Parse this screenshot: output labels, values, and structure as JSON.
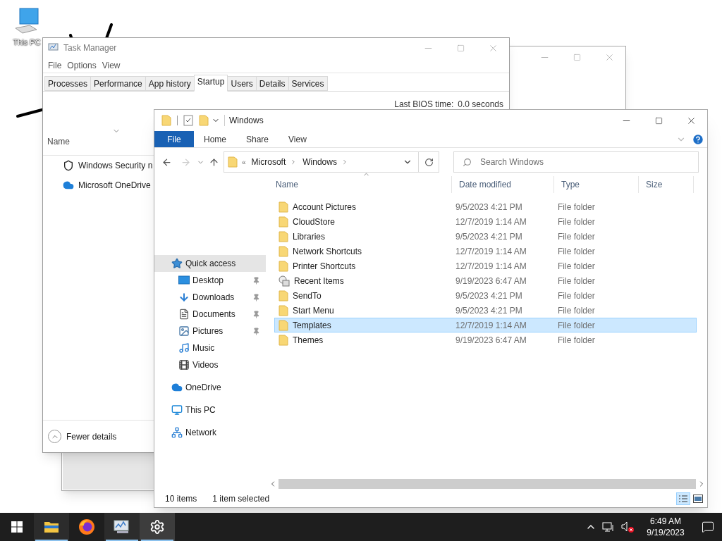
{
  "desktop": {
    "icons": [
      {
        "label": "This PC"
      }
    ]
  },
  "task_manager": {
    "title": "Task Manager",
    "menu": [
      "File",
      "Options",
      "View"
    ],
    "tabs": [
      {
        "label": "Processes",
        "selected": false
      },
      {
        "label": "Performance",
        "selected": false
      },
      {
        "label": "App history",
        "selected": false
      },
      {
        "label": "Startup",
        "selected": true
      },
      {
        "label": "Users",
        "selected": false
      },
      {
        "label": "Details",
        "selected": false
      },
      {
        "label": "Services",
        "selected": false
      }
    ],
    "bios_label": "Last BIOS time:",
    "bios_value": "0.0 seconds",
    "column": "Name",
    "startup_items": [
      {
        "name": "Windows Security n",
        "kind": "shield"
      },
      {
        "name": "Microsoft OneDrive",
        "kind": "cloud"
      }
    ],
    "footer": "Fewer details"
  },
  "explorer": {
    "title": "Windows",
    "ribbon_tabs": [
      {
        "label": "File",
        "kind": "file"
      },
      {
        "label": "Home",
        "kind": "tab"
      },
      {
        "label": "Share",
        "kind": "tab"
      },
      {
        "label": "View",
        "kind": "tab"
      }
    ],
    "overflow_mark": "«",
    "path": [
      "Microsoft",
      "Windows"
    ],
    "search": {
      "placeholder": "Search Windows"
    },
    "nav": [
      {
        "label": "Quick access",
        "kind": "quick",
        "selected": true,
        "children": [
          {
            "label": "Desktop",
            "kind": "desktop",
            "pinned": true
          },
          {
            "label": "Downloads",
            "kind": "downloads",
            "pinned": true
          },
          {
            "label": "Documents",
            "kind": "documents",
            "pinned": true
          },
          {
            "label": "Pictures",
            "kind": "pictures",
            "pinned": true
          },
          {
            "label": "Music",
            "kind": "music",
            "pinned": false
          },
          {
            "label": "Videos",
            "kind": "videos",
            "pinned": false
          }
        ]
      },
      {
        "label": "OneDrive",
        "kind": "onedrive",
        "selected": false
      },
      {
        "label": "This PC",
        "kind": "pc",
        "selected": false
      },
      {
        "label": "Network",
        "kind": "network",
        "selected": false
      }
    ],
    "columns": [
      "Name",
      "Date modified",
      "Type",
      "Size"
    ],
    "rows": [
      {
        "name": "Account Pictures",
        "date": "9/5/2023 4:21 PM",
        "type": "File folder",
        "kind": "folder",
        "selected": false
      },
      {
        "name": "CloudStore",
        "date": "12/7/2019 1:14 AM",
        "type": "File folder",
        "kind": "folder",
        "selected": false
      },
      {
        "name": "Libraries",
        "date": "9/5/2023 4:21 PM",
        "type": "File folder",
        "kind": "folder",
        "selected": false
      },
      {
        "name": "Network Shortcuts",
        "date": "12/7/2019 1:14 AM",
        "type": "File folder",
        "kind": "folder",
        "selected": false
      },
      {
        "name": "Printer Shortcuts",
        "date": "12/7/2019 1:14 AM",
        "type": "File folder",
        "kind": "folder",
        "selected": false
      },
      {
        "name": "Recent Items",
        "date": "9/19/2023 6:47 AM",
        "type": "File folder",
        "kind": "special",
        "selected": false
      },
      {
        "name": "SendTo",
        "date": "9/5/2023 4:21 PM",
        "type": "File folder",
        "kind": "folder",
        "selected": false
      },
      {
        "name": "Start Menu",
        "date": "9/5/2023 4:21 PM",
        "type": "File folder",
        "kind": "folder",
        "selected": false
      },
      {
        "name": "Templates",
        "date": "12/7/2019 1:14 AM",
        "type": "File folder",
        "kind": "folder",
        "selected": true
      },
      {
        "name": "Themes",
        "date": "9/19/2023 6:47 AM",
        "type": "File folder",
        "kind": "folder",
        "selected": false
      }
    ],
    "status": {
      "count": "10 items",
      "selection": "1 item selected"
    }
  },
  "taskbar": {
    "apps": [
      {
        "kind": "explorer",
        "running": true,
        "selected": false
      },
      {
        "kind": "firefox",
        "running": false,
        "selected": false
      },
      {
        "kind": "taskmgr",
        "running": true,
        "selected": false
      },
      {
        "kind": "settings",
        "running": true,
        "selected": true
      }
    ],
    "time": "6:49 AM",
    "date": "9/19/2023"
  }
}
